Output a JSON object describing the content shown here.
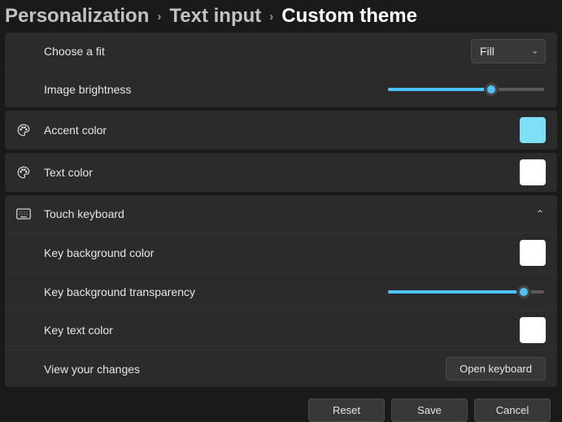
{
  "breadcrumb": {
    "items": [
      "Personalization",
      "Text input",
      "Custom theme"
    ]
  },
  "fit": {
    "label": "Choose a fit",
    "selected": "Fill"
  },
  "brightness": {
    "label": "Image brightness",
    "percent": 66
  },
  "accent": {
    "label": "Accent color",
    "color": "#7ee0f5"
  },
  "textcolor": {
    "label": "Text color",
    "color": "#ffffff"
  },
  "touch": {
    "label": "Touch keyboard",
    "expanded": true,
    "keybg": {
      "label": "Key background color",
      "color": "#ffffff"
    },
    "keytrans": {
      "label": "Key background transparency",
      "percent": 87
    },
    "keytext": {
      "label": "Key text color",
      "color": "#ffffff"
    },
    "view": {
      "label": "View your changes",
      "button": "Open keyboard"
    }
  },
  "footer": {
    "reset": "Reset",
    "save": "Save",
    "cancel": "Cancel"
  }
}
